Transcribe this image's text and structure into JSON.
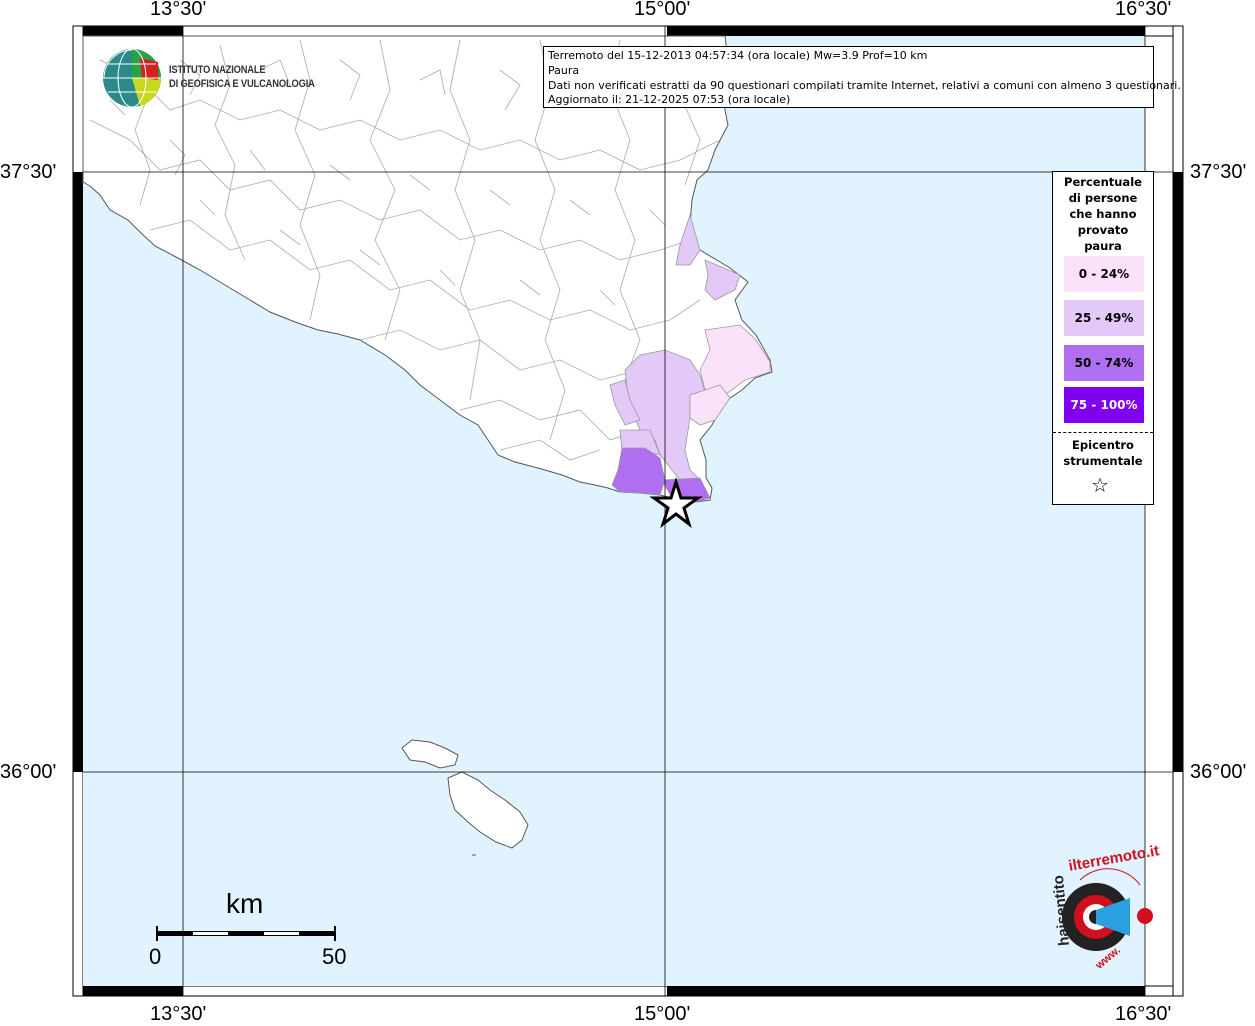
{
  "map": {
    "lon_ticks_top": [
      "13°30'",
      "15°00'",
      "16°30'"
    ],
    "lon_ticks_bottom": [
      "13°30'",
      "15°00'",
      "16°30'"
    ],
    "lat_ticks_left": [
      "37°30'",
      "36°00'"
    ],
    "lat_ticks_right": [
      "37°30'",
      "36°00'"
    ],
    "sea_color": "#e0f3fe",
    "land_color": "#ffffff",
    "border_color": "#999999"
  },
  "institute": {
    "line1": "ISTITUTO NAZIONALE",
    "line2": "DI GEOFISICA E VULCANOLOGIA"
  },
  "info": {
    "line1": "Terremoto del 15-12-2013 04:57:34 (ora locale) Mw=3.9 Prof=10 km",
    "line2": "Paura",
    "line3": "Dati non verificati estratti da 90 questionari compilati tramite Internet, relativi a comuni con almeno 3 questionari.",
    "line4": "Aggiornato il: 21-12-2025 07:53 (ora locale)"
  },
  "legend": {
    "title_lines": [
      "Percentuale",
      "di persone",
      "che hanno",
      "provato",
      "paura"
    ],
    "classes": [
      {
        "label": "0 - 24%",
        "color": "#fbe2fb",
        "text_color": "#000000"
      },
      {
        "label": "25 - 49%",
        "color": "#e2c9f7",
        "text_color": "#000000"
      },
      {
        "label": "50 - 74%",
        "color": "#b06ff0",
        "text_color": "#000000"
      },
      {
        "label": "75 - 100%",
        "color": "#8000f0",
        "text_color": "#ffffff"
      }
    ],
    "epicenter_label_lines": [
      "Epicentro",
      "strumentale"
    ],
    "epicenter_symbol": "☆"
  },
  "scale_bar": {
    "unit": "km",
    "start": "0",
    "end": "50"
  },
  "site_logo": {
    "text_black": "haisentito",
    "text_red": "ilterremoto.it",
    "text_prefix": "www."
  },
  "icons": {
    "ingv_logo": "globe-icon",
    "epicenter": "star-icon",
    "site_logo": "megaphone-icon"
  }
}
